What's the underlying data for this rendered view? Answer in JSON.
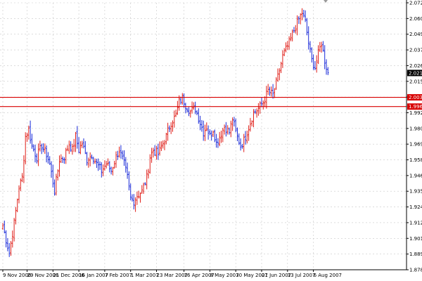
{
  "chart_data": {
    "type": "bar",
    "title": "",
    "xlabel": "",
    "ylabel": "",
    "ylim": [
      1.878,
      2.072
    ],
    "grid": true,
    "colors": {
      "background": "#ffffff",
      "grid": "#c8c8c8",
      "bull": "#e0201a",
      "bear": "#1a2ad8",
      "hline": "#d80000",
      "current_tag": "#000000",
      "axis": "#000000"
    },
    "y_ticks": [
      "2.0720",
      "2.0605",
      "2.0490",
      "2.0375",
      "2.0265",
      "2.0150",
      "2.0035",
      "1.9920",
      "1.9805",
      "1.9695",
      "1.9580",
      "1.9465",
      "1.9350",
      "1.9240",
      "1.9125",
      "1.9010",
      "1.8895",
      "1.8780"
    ],
    "x_ticks": [
      {
        "label": "9 Nov 2006",
        "index": 0
      },
      {
        "label": "29 Nov 2006",
        "index": 15
      },
      {
        "label": "21 Dec 2006",
        "index": 31
      },
      {
        "label": "16 Jan 2007",
        "index": 47
      },
      {
        "label": "7 Feb 2007",
        "index": 63
      },
      {
        "label": "1 Mar 2007",
        "index": 79
      },
      {
        "label": "23 Mar 2007",
        "index": 95
      },
      {
        "label": "16 Apr 2007",
        "index": 112
      },
      {
        "label": "8 May 2007",
        "index": 128
      },
      {
        "label": "30 May 2007",
        "index": 144
      },
      {
        "label": "21 Jun 2007",
        "index": 160
      },
      {
        "label": "13 Jul 2007",
        "index": 176
      },
      {
        "label": "6 Aug 2007",
        "index": 192
      }
    ],
    "horizontal_lines": [
      {
        "label": "2.0033",
        "value": 2.0033
      },
      {
        "label": "1.9966",
        "value": 1.9966
      }
    ],
    "current_price": {
      "label": "2.0210",
      "value": 2.021
    },
    "anchors": [
      [
        0,
        1.91
      ],
      [
        4,
        1.89
      ],
      [
        7,
        1.912
      ],
      [
        10,
        1.938
      ],
      [
        12,
        1.945
      ],
      [
        14,
        1.975
      ],
      [
        16,
        1.98
      ],
      [
        18,
        1.968
      ],
      [
        21,
        1.96
      ],
      [
        24,
        1.968
      ],
      [
        27,
        1.962
      ],
      [
        29,
        1.955
      ],
      [
        32,
        1.935
      ],
      [
        35,
        1.958
      ],
      [
        38,
        1.96
      ],
      [
        41,
        1.97
      ],
      [
        43,
        1.965
      ],
      [
        45,
        1.975
      ],
      [
        47,
        1.965
      ],
      [
        49,
        1.97
      ],
      [
        52,
        1.958
      ],
      [
        55,
        1.962
      ],
      [
        58,
        1.955
      ],
      [
        61,
        1.95
      ],
      [
        64,
        1.955
      ],
      [
        67,
        1.95
      ],
      [
        70,
        1.96
      ],
      [
        72,
        1.965
      ],
      [
        75,
        1.955
      ],
      [
        77,
        1.945
      ],
      [
        79,
        1.93
      ],
      [
        81,
        1.928
      ],
      [
        83,
        1.932
      ],
      [
        86,
        1.935
      ],
      [
        89,
        1.945
      ],
      [
        91,
        1.96
      ],
      [
        93,
        1.965
      ],
      [
        96,
        1.962
      ],
      [
        99,
        1.97
      ],
      [
        101,
        1.975
      ],
      [
        104,
        1.985
      ],
      [
        107,
        1.99
      ],
      [
        109,
        2.0
      ],
      [
        111,
        2.003
      ],
      [
        113,
        1.998
      ],
      [
        116,
        1.993
      ],
      [
        119,
        1.995
      ],
      [
        122,
        1.985
      ],
      [
        124,
        1.978
      ],
      [
        126,
        1.982
      ],
      [
        128,
        1.975
      ],
      [
        130,
        1.98
      ],
      [
        132,
        1.97
      ],
      [
        134,
        1.975
      ],
      [
        137,
        1.982
      ],
      [
        140,
        1.978
      ],
      [
        142,
        1.988
      ],
      [
        144,
        1.978
      ],
      [
        147,
        1.968
      ],
      [
        149,
        1.972
      ],
      [
        151,
        1.978
      ],
      [
        153,
        1.985
      ],
      [
        155,
        1.992
      ],
      [
        158,
        1.995
      ],
      [
        161,
        2.0
      ],
      [
        164,
        2.008
      ],
      [
        167,
        2.005
      ],
      [
        170,
        2.018
      ],
      [
        173,
        2.033
      ],
      [
        175,
        2.038
      ],
      [
        177,
        2.043
      ],
      [
        180,
        2.052
      ],
      [
        183,
        2.06
      ],
      [
        185,
        2.065
      ],
      [
        187,
        2.058
      ],
      [
        189,
        2.043
      ],
      [
        191,
        2.03
      ],
      [
        193,
        2.025
      ],
      [
        195,
        2.035
      ],
      [
        197,
        2.043
      ],
      [
        199,
        2.03
      ],
      [
        201,
        2.021
      ]
    ]
  }
}
